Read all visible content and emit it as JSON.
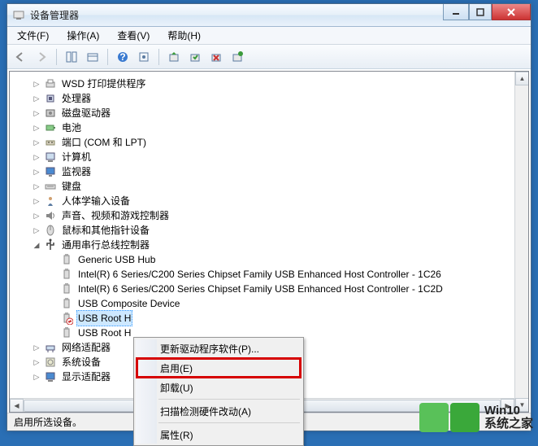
{
  "window": {
    "title": "设备管理器"
  },
  "menu": {
    "file": "文件(F)",
    "action": "操作(A)",
    "view": "查看(V)",
    "help": "帮助(H)"
  },
  "tree": {
    "items": [
      {
        "label": "WSD 打印提供程序",
        "indent": 1,
        "exp": "▷",
        "icon": "printer"
      },
      {
        "label": "处理器",
        "indent": 1,
        "exp": "▷",
        "icon": "cpu"
      },
      {
        "label": "磁盘驱动器",
        "indent": 1,
        "exp": "▷",
        "icon": "disk"
      },
      {
        "label": "电池",
        "indent": 1,
        "exp": "▷",
        "icon": "battery"
      },
      {
        "label": "端口 (COM 和 LPT)",
        "indent": 1,
        "exp": "▷",
        "icon": "port"
      },
      {
        "label": "计算机",
        "indent": 1,
        "exp": "▷",
        "icon": "computer"
      },
      {
        "label": "监视器",
        "indent": 1,
        "exp": "▷",
        "icon": "monitor"
      },
      {
        "label": "键盘",
        "indent": 1,
        "exp": "▷",
        "icon": "keyboard"
      },
      {
        "label": "人体学输入设备",
        "indent": 1,
        "exp": "▷",
        "icon": "hid"
      },
      {
        "label": "声音、视频和游戏控制器",
        "indent": 1,
        "exp": "▷",
        "icon": "sound"
      },
      {
        "label": "鼠标和其他指针设备",
        "indent": 1,
        "exp": "▷",
        "icon": "mouse"
      },
      {
        "label": "通用串行总线控制器",
        "indent": 1,
        "exp": "◢",
        "icon": "usb"
      },
      {
        "label": "Generic USB Hub",
        "indent": 2,
        "exp": "",
        "icon": "usb-dev"
      },
      {
        "label": "Intel(R) 6 Series/C200 Series Chipset Family USB Enhanced Host Controller - 1C26",
        "indent": 2,
        "exp": "",
        "icon": "usb-dev"
      },
      {
        "label": "Intel(R) 6 Series/C200 Series Chipset Family USB Enhanced Host Controller - 1C2D",
        "indent": 2,
        "exp": "",
        "icon": "usb-dev"
      },
      {
        "label": "USB Composite Device",
        "indent": 2,
        "exp": "",
        "icon": "usb-dev"
      },
      {
        "label": "USB Root H",
        "indent": 2,
        "exp": "",
        "icon": "usb-dev-disabled",
        "selected": true
      },
      {
        "label": "USB Root H",
        "indent": 2,
        "exp": "",
        "icon": "usb-dev"
      },
      {
        "label": "网络适配器",
        "indent": 1,
        "exp": "▷",
        "icon": "net"
      },
      {
        "label": "系统设备",
        "indent": 1,
        "exp": "▷",
        "icon": "system"
      },
      {
        "label": "显示适配器",
        "indent": 1,
        "exp": "▷",
        "icon": "display"
      }
    ]
  },
  "context_menu": {
    "update": "更新驱动程序软件(P)...",
    "enable": "启用(E)",
    "uninstall": "卸载(U)",
    "scan": "扫描检测硬件改动(A)",
    "properties": "属性(R)"
  },
  "statusbar": {
    "text": "启用所选设备。"
  },
  "watermark": {
    "line1": "Win10",
    "line2": "系统之家"
  }
}
